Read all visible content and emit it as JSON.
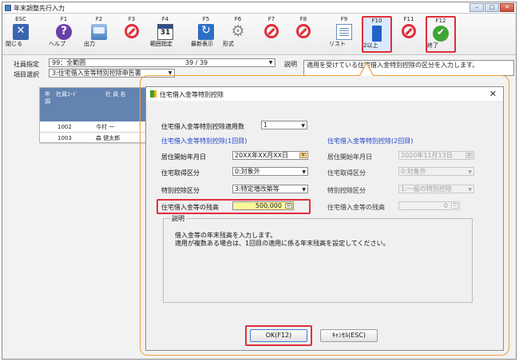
{
  "window": {
    "title": "年末調整先行入力",
    "controls": [
      "–",
      "□",
      "✕"
    ]
  },
  "toolbar": [
    {
      "key": "ESC",
      "label": "閉じる",
      "icon": "exit-icon"
    },
    {
      "key": "F1",
      "label": "ヘルプ",
      "icon": "help-icon"
    },
    {
      "key": "F2",
      "label": "出力",
      "icon": "print-icon"
    },
    {
      "key": "F3",
      "label": "",
      "icon": "disabled-icon"
    },
    {
      "key": "F4",
      "label": "範囲指定",
      "icon": "calendar-icon"
    },
    {
      "key": "F5",
      "label": "最新表示",
      "icon": "refresh-icon"
    },
    {
      "key": "F6",
      "label": "形式",
      "icon": "gear-icon"
    },
    {
      "key": "F7",
      "label": "",
      "icon": "disabled-icon"
    },
    {
      "key": "F8",
      "label": "",
      "icon": "disabled-icon"
    },
    {
      "key": "F9",
      "label": "リスト",
      "icon": "list-icon"
    },
    {
      "key": "F10",
      "label": "2以上",
      "icon": "book-icon"
    },
    {
      "key": "F11",
      "label": "",
      "icon": "disabled-icon"
    },
    {
      "key": "F12",
      "label": "終了",
      "icon": "check-icon"
    }
  ],
  "header": {
    "employee_label": "社員指定",
    "employee_value": "99：全範囲",
    "employee_count": "39 / 39",
    "item_label": "項目選択",
    "item_value": "3:住宅借入金等特別控除申告書",
    "desc_label": "説明",
    "desc_text": "適用を受けている住宅借入金特別控除の区分を入力します。"
  },
  "grid": {
    "col_year": "年調",
    "col_code": "社員ｺｰﾄﾞ",
    "col_name": "社 員 名",
    "rows": [
      {
        "code": "1002",
        "name": "今村 一"
      },
      {
        "code": "1003",
        "name": "森 健太郎"
      }
    ]
  },
  "dialog": {
    "title": "住宅借入金等特別控除",
    "apply_count_label": "住宅借入金等特別控除適用数",
    "apply_count_value": "1",
    "first_section": "住宅借入金等特別控除(1回目)",
    "second_section": "住宅借入金等特別控除(2回目)",
    "move_in_label": "居住開始年月日",
    "move_in_value_1": "20XX年XX月XX日",
    "move_in_value_2": "2020年11月13日",
    "acq_label": "住宅取得区分",
    "acq_value_1": "0:対象外",
    "acq_value_2": "0:対象外",
    "special_label": "特別控除区分",
    "special_value_1": "3:特定増改築等",
    "special_value_2": "1:一般の特別控除",
    "balance_label": "住宅借入金等の残高",
    "balance_value_1": "500,000",
    "balance_value_2": "0",
    "desc_title": "説明",
    "desc_line1": "借入金等の年末残高を入力します。",
    "desc_line2": "適用が複数ある場合は、1回目の適用に係る年末残高を設定してください。",
    "ok_label": "OK(F12)",
    "cancel_label": "ｷｬﾝｾﾙ(ESC)"
  }
}
